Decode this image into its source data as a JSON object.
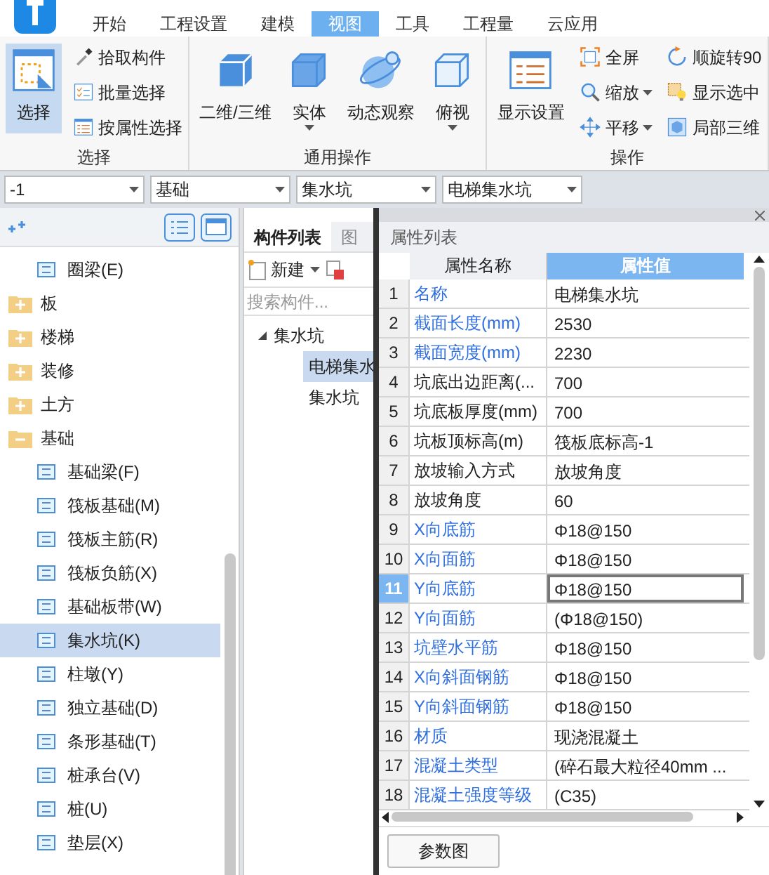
{
  "ribbon_tabs": [
    {
      "label": "开始",
      "selected": false
    },
    {
      "label": "工程设置",
      "selected": false
    },
    {
      "label": "建模",
      "selected": false
    },
    {
      "label": "视图",
      "selected": true
    },
    {
      "label": "工具",
      "selected": false
    },
    {
      "label": "工程量",
      "selected": false
    },
    {
      "label": "云应用",
      "selected": false
    }
  ],
  "ribbon_groups": [
    {
      "title": "选择",
      "big": [
        {
          "label": "选择",
          "selected": true,
          "dropdown": false
        }
      ],
      "small": [
        {
          "label": "拾取构件",
          "dropdown": false
        },
        {
          "label": "批量选择",
          "dropdown": false
        },
        {
          "label": "按属性选择",
          "dropdown": false
        }
      ]
    },
    {
      "title": "通用操作",
      "big": [
        {
          "label": "二维/三维",
          "selected": false,
          "dropdown": false
        },
        {
          "label": "实体",
          "selected": false,
          "dropdown": true
        },
        {
          "label": "动态观察",
          "selected": false,
          "dropdown": false
        },
        {
          "label": "俯视",
          "selected": false,
          "dropdown": true
        }
      ]
    },
    {
      "title": "操作",
      "big": [
        {
          "label": "显示设置",
          "selected": false,
          "dropdown": false
        }
      ],
      "small": [
        {
          "label": "全屏",
          "dropdown": false
        },
        {
          "label": "缩放",
          "dropdown": true
        },
        {
          "label": "平移",
          "dropdown": true
        },
        {
          "label": "顺旋转90",
          "dropdown": false
        },
        {
          "label": "显示选中",
          "dropdown": false
        },
        {
          "label": "局部三维",
          "dropdown": false
        }
      ]
    }
  ],
  "selectors": [
    "-1",
    "基础",
    "集水坑",
    "电梯集水坑"
  ],
  "navigator": {
    "items": [
      {
        "label": "圈梁(E)",
        "kind": "leaf"
      },
      {
        "label": "板",
        "kind": "folder",
        "expanded": false
      },
      {
        "label": "楼梯",
        "kind": "folder",
        "expanded": false
      },
      {
        "label": "装修",
        "kind": "folder",
        "expanded": false
      },
      {
        "label": "土方",
        "kind": "folder",
        "expanded": false
      },
      {
        "label": "基础",
        "kind": "folder",
        "expanded": true,
        "children": [
          {
            "label": "基础梁(F)",
            "kind": "leaf",
            "selected": false
          },
          {
            "label": "筏板基础(M)",
            "kind": "leaf",
            "selected": false
          },
          {
            "label": "筏板主筋(R)",
            "kind": "leaf",
            "selected": false
          },
          {
            "label": "筏板负筋(X)",
            "kind": "leaf",
            "selected": false
          },
          {
            "label": "基础板带(W)",
            "kind": "leaf",
            "selected": false
          },
          {
            "label": "集水坑(K)",
            "kind": "leaf",
            "selected": true
          },
          {
            "label": "柱墩(Y)",
            "kind": "leaf",
            "selected": false
          },
          {
            "label": "独立基础(D)",
            "kind": "leaf",
            "selected": false
          },
          {
            "label": "条形基础(T)",
            "kind": "leaf",
            "selected": false
          },
          {
            "label": "桩承台(V)",
            "kind": "leaf",
            "selected": false
          },
          {
            "label": "桩(U)",
            "kind": "leaf",
            "selected": false
          },
          {
            "label": "垫层(X)",
            "kind": "leaf",
            "selected": false
          }
        ]
      }
    ]
  },
  "component_list": {
    "tabs": [
      {
        "label": "构件列表",
        "selected": true
      },
      {
        "label": "图",
        "selected": false
      }
    ],
    "new_button": "新建",
    "search": {
      "placeholder": "搜索构件..."
    },
    "tree": [
      {
        "label": "集水坑",
        "expanded": true,
        "selected": false,
        "children": [
          {
            "label": "电梯集水",
            "selected": true
          },
          {
            "label": "集水坑",
            "selected": false
          }
        ]
      }
    ]
  },
  "properties": {
    "title": "属性列表",
    "columns": [
      "属性名称",
      "属性值"
    ],
    "rows": [
      {
        "no": "1",
        "name": "名称",
        "value": "电梯集水坑",
        "public": true,
        "selected": false
      },
      {
        "no": "2",
        "name": "截面长度(mm)",
        "value": "2530",
        "public": true,
        "selected": false
      },
      {
        "no": "3",
        "name": "截面宽度(mm)",
        "value": "2230",
        "public": true,
        "selected": false
      },
      {
        "no": "4",
        "name": "坑底出边距离(...",
        "value": "700",
        "public": false,
        "selected": false
      },
      {
        "no": "5",
        "name": "坑底板厚度(mm)",
        "value": "700",
        "public": false,
        "selected": false
      },
      {
        "no": "6",
        "name": "坑板顶标高(m)",
        "value": "筏板底标高-1",
        "public": false,
        "selected": false
      },
      {
        "no": "7",
        "name": "放坡输入方式",
        "value": "放坡角度",
        "public": false,
        "selected": false
      },
      {
        "no": "8",
        "name": "放坡角度",
        "value": "60",
        "public": false,
        "selected": false
      },
      {
        "no": "9",
        "name": "X向底筋",
        "value": "Φ18@150",
        "public": true,
        "selected": false
      },
      {
        "no": "10",
        "name": "X向面筋",
        "value": "Φ18@150",
        "public": true,
        "selected": false
      },
      {
        "no": "11",
        "name": "Y向底筋",
        "value": "Φ18@150",
        "public": true,
        "selected": true
      },
      {
        "no": "12",
        "name": "Y向面筋",
        "value": "(Φ18@150)",
        "public": true,
        "selected": false
      },
      {
        "no": "13",
        "name": "坑壁水平筋",
        "value": "Φ18@150",
        "public": true,
        "selected": false
      },
      {
        "no": "14",
        "name": "X向斜面钢筋",
        "value": "Φ18@150",
        "public": true,
        "selected": false
      },
      {
        "no": "15",
        "name": "Y向斜面钢筋",
        "value": "Φ18@150",
        "public": true,
        "selected": false
      },
      {
        "no": "16",
        "name": "材质",
        "value": "现浇混凝土",
        "public": true,
        "selected": false
      },
      {
        "no": "17",
        "name": "混凝土类型",
        "value": "(碎石最大粒径40mm ...",
        "public": true,
        "selected": false
      },
      {
        "no": "18",
        "name": "混凝土强度等级",
        "value": "(C35)",
        "public": true,
        "selected": false
      }
    ],
    "button": "参数图"
  }
}
